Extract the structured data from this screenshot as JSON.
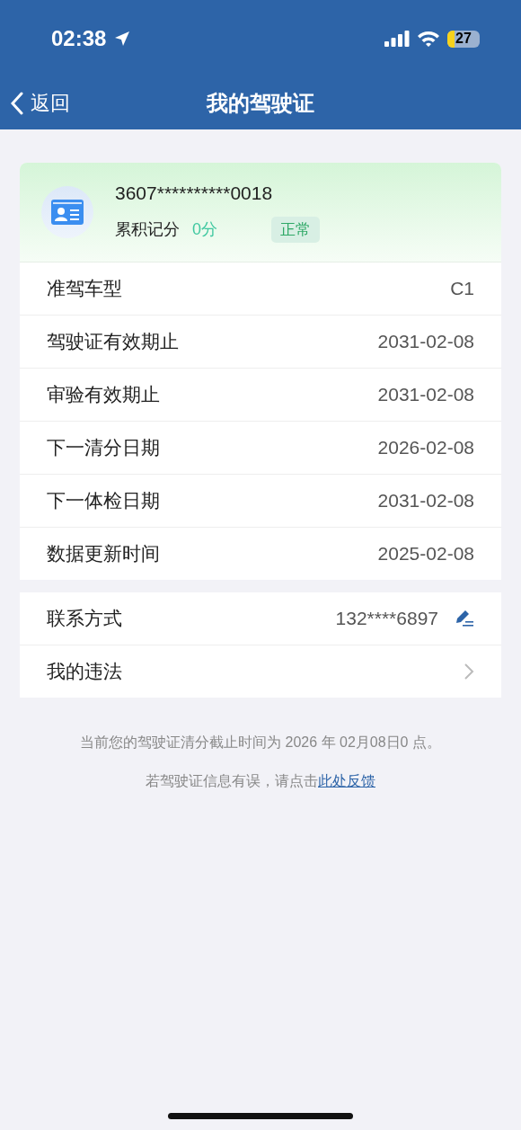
{
  "status_bar": {
    "time": "02:38",
    "battery": "27"
  },
  "nav": {
    "back": "返回",
    "title": "我的驾驶证"
  },
  "license": {
    "number": "3607**********0018",
    "points_label": "累积记分",
    "points": "0分",
    "status": "正常"
  },
  "details": [
    {
      "label": "准驾车型",
      "value": "C1"
    },
    {
      "label": "驾驶证有效期止",
      "value": "2031-02-08"
    },
    {
      "label": "审验有效期止",
      "value": "2031-02-08"
    },
    {
      "label": "下一清分日期",
      "value": "2026-02-08"
    },
    {
      "label": "下一体检日期",
      "value": "2031-02-08"
    },
    {
      "label": "数据更新时间",
      "value": "2025-02-08"
    }
  ],
  "links": [
    {
      "kind": "edit",
      "label": "联系方式",
      "value": "132****6897"
    },
    {
      "kind": "chevron",
      "label": "我的违法"
    }
  ],
  "notes": {
    "deadline": "当前您的驾驶证清分截止时间为 2026 年 02月08日0 点。",
    "feedback_text": "若驾驶证信息有误，请点击",
    "feedback_link": "此处反馈"
  }
}
